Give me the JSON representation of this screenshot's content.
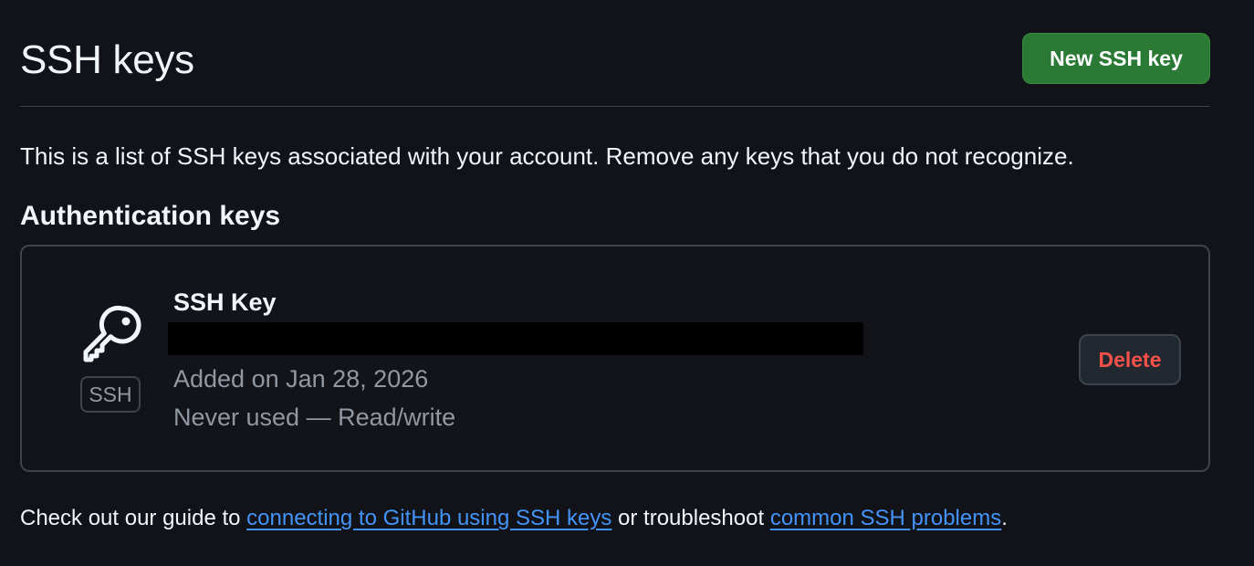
{
  "header": {
    "title": "SSH keys",
    "new_key_label": "New SSH key"
  },
  "intro": "This is a list of SSH keys associated with your account. Remove any keys that you do not recognize.",
  "section": {
    "heading": "Authentication keys"
  },
  "keys": [
    {
      "icon": "key-icon",
      "type_label": "SSH",
      "title": "SSH Key",
      "added": "Added on Jan 28, 2026",
      "usage": "Never used — Read/write",
      "delete_label": "Delete"
    }
  ],
  "footer": {
    "prefix": "Check out our guide to ",
    "link1": "connecting to GitHub using SSH keys",
    "middle": " or troubleshoot ",
    "link2": "common SSH problems",
    "suffix": "."
  },
  "colors": {
    "background": "#111319",
    "primary_button": "#2a7a35",
    "danger_text": "#f85149",
    "link": "#4493f8",
    "muted_text": "#9198a1",
    "border": "#3d444d"
  }
}
